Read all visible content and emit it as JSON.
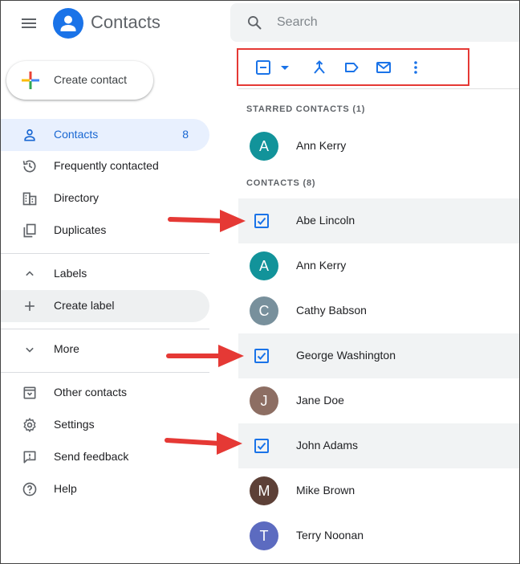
{
  "header": {
    "app_title": "Contacts",
    "search_placeholder": "Search"
  },
  "sidebar": {
    "create_label": "Create contact",
    "items": [
      {
        "label": "Contacts",
        "count": "8",
        "icon": "person-icon",
        "active": true
      },
      {
        "label": "Frequently contacted",
        "icon": "history-icon"
      },
      {
        "label": "Directory",
        "icon": "domain-icon"
      },
      {
        "label": "Duplicates",
        "icon": "copy-icon"
      }
    ],
    "labels_header": "Labels",
    "create_label_item": "Create label",
    "more": "More",
    "footer_items": [
      {
        "label": "Other contacts",
        "icon": "archive-icon"
      },
      {
        "label": "Settings",
        "icon": "gear-icon"
      },
      {
        "label": "Send feedback",
        "icon": "feedback-icon"
      },
      {
        "label": "Help",
        "icon": "help-icon"
      }
    ]
  },
  "toolbar": {
    "icons": [
      "select-dropdown-icon",
      "merge-icon",
      "label-icon",
      "email-icon",
      "more-vert-icon"
    ]
  },
  "starred": {
    "header": "STARRED CONTACTS (1)",
    "contacts": [
      {
        "name": "Ann Kerry",
        "initial": "A",
        "color": "#12939a"
      }
    ]
  },
  "contacts": {
    "header": "CONTACTS (8)",
    "list": [
      {
        "name": "Abe Lincoln",
        "selected": true
      },
      {
        "name": "Ann Kerry",
        "initial": "A",
        "color": "#12939a",
        "selected": false
      },
      {
        "name": "Cathy Babson",
        "initial": "C",
        "color": "#78909c",
        "selected": false
      },
      {
        "name": "George Washington",
        "selected": true
      },
      {
        "name": "Jane Doe",
        "initial": "J",
        "color": "#8d6e63",
        "selected": false
      },
      {
        "name": "John Adams",
        "selected": true
      },
      {
        "name": "Mike Brown",
        "initial": "M",
        "color": "#5d4037",
        "selected": false
      },
      {
        "name": "Terry Noonan",
        "initial": "T",
        "color": "#5c6bc0",
        "selected": false
      }
    ]
  },
  "colors": {
    "accent": "#1a73e8",
    "annotation": "#e53935"
  }
}
